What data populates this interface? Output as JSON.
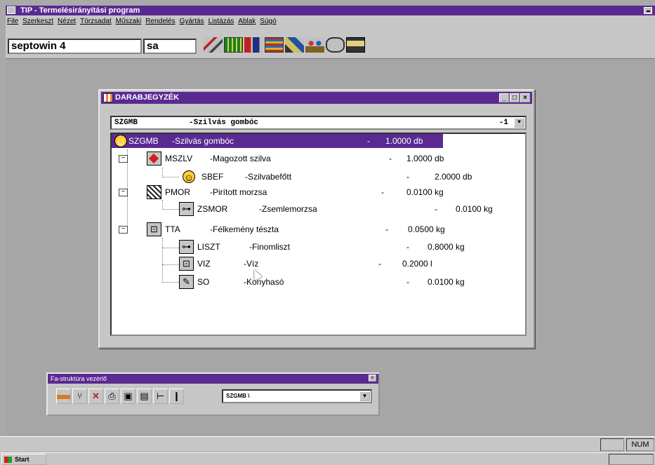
{
  "app": {
    "title": "TIP - Termelésirányítási program"
  },
  "menu": [
    "File",
    "Szerkeszt",
    "Nézet",
    "Törzsadat",
    "Műszaki",
    "Rendelés",
    "Gyártás",
    "Listázás",
    "Ablak",
    "Súgó"
  ],
  "toolbar": {
    "db_value": "septowin 4",
    "user_value": "sa",
    "icons": [
      "tools-icon",
      "chart-icon",
      "report-icon",
      "inventory-icon",
      "machine-icon",
      "people-icon",
      "circle-icon",
      "save-icon"
    ]
  },
  "bom_window": {
    "title": "DARABJEGYZÉK",
    "controls": {
      "minimize": "_",
      "maximize": "□",
      "close": "×"
    },
    "selector": {
      "code": "SZGMB",
      "name": "-Szilvás gombóc",
      "value": "-1"
    },
    "tree": [
      {
        "code": "SZGMB",
        "name": "-Szilvás gombóc",
        "dash": "-",
        "qty": "1.0000 db",
        "icon": "smiley-icon",
        "selected": true
      },
      {
        "code": "MSZLV",
        "name": "-Magozott szilva",
        "dash": "-",
        "qty": "1.0000 db",
        "icon": "diamond-icon"
      },
      {
        "code": "SBEF",
        "name": "-Szilvabefőtt",
        "dash": "-",
        "qty": "2.0000 db",
        "icon": "smiley-icon"
      },
      {
        "code": "PMOR",
        "name": "-Pirított morzsa",
        "dash": "-",
        "qty": "0.0100 kg",
        "icon": "grid-icon"
      },
      {
        "code": "ZSMOR",
        "name": "-Zsemlemorzsa",
        "dash": "-",
        "qty": "0.0100 kg",
        "icon": "key-icon"
      },
      {
        "code": "TTA",
        "name": "-Félkemény tészta",
        "dash": "-",
        "qty": "0.0500 kg",
        "icon": "bread-icon"
      },
      {
        "code": "LISZT",
        "name": "-Finomliszt",
        "dash": "-",
        "qty": "0.8000 kg",
        "icon": "key-icon"
      },
      {
        "code": "VIZ",
        "name": "-Víz",
        "dash": "-",
        "qty": "0.2000 l",
        "icon": "bread-icon"
      },
      {
        "code": "SO",
        "name": "-Konyhasó",
        "dash": "-",
        "qty": "0.0100 kg",
        "icon": "pen-icon"
      }
    ]
  },
  "tree_control": {
    "title": "Fa-struktúra vezérlő",
    "close": "×",
    "combo_value": "SZGMB   \\",
    "icons": [
      "layer-icon",
      "branch-icon",
      "delete-icon",
      "print-icon",
      "window-icon",
      "save-icon",
      "expand-icon",
      "collapse-icon"
    ]
  },
  "status": {
    "num": "NUM"
  },
  "taskbar": {
    "start": "Start"
  }
}
